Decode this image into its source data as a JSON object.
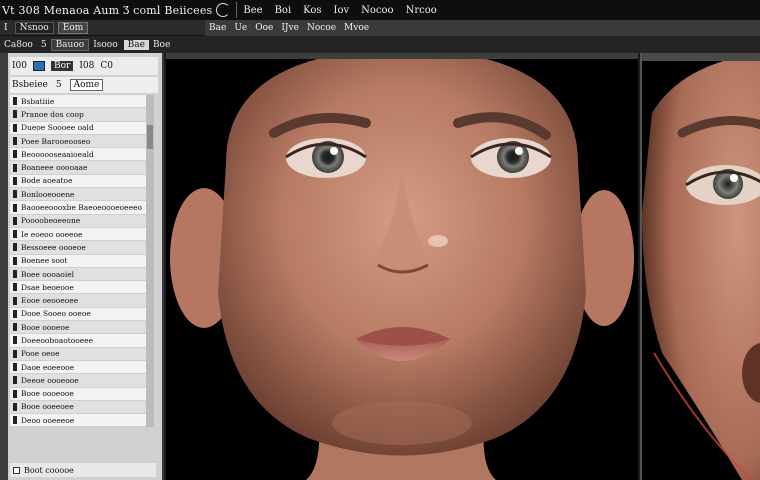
{
  "app": {
    "title": "Vt 308 Menaoa Aum Ʒ coml Beiicees",
    "menu": [
      "Bee",
      "Boi",
      "Kos",
      "Iov",
      "Nocoo",
      "Nrcoo"
    ]
  },
  "toolbar": {
    "left": [
      "I",
      "Nsnoo",
      "Eom"
    ],
    "right": [
      "Bae",
      "Ue",
      "Ooe",
      "IJve",
      "Nocoe",
      "Mvoe"
    ]
  },
  "toolbar2": {
    "items": [
      "Ca8oo",
      "5",
      "Bauoo",
      "Isooo",
      "Bae",
      "Boe"
    ]
  },
  "left_panel": {
    "header": [
      "I00",
      "Bor",
      "I08",
      "C0"
    ],
    "sub": [
      "Bsbeiee",
      "5",
      "Aome"
    ],
    "items": [
      "Bsbatiiie",
      "Pranoe dos coop",
      "Dueoe Soooee oald",
      "Poee Barooeooseo",
      "Beoooooseaaioeald",
      "Boaneee ooooaae",
      "Bode aoeatoe",
      "Bonlooeooene",
      "Baooeeoooxbe Baeoeoooeoeeeo",
      "Poooobeoeeone",
      "Ie eoeoo ooeeoe",
      "Bessoeee oooeoe",
      "Boenee soot",
      "Boee oooaoiel",
      "Dsae beoeooe",
      "Eooe oeooeoee",
      "Dooe Sooeo ooeoe",
      "Booe oooeoe",
      "Doeeooboaotooeee",
      "Pooe oeoe",
      "Daoe eoeeooe",
      "Deeoe oooeooe",
      "Booe oooeooe",
      "Booe ooeeoee",
      "Deoo ooeeeoe"
    ],
    "footer": "Boot cooooe"
  },
  "colors": {
    "titlebar": "#0e0e0e",
    "panel": "#d1d1d1",
    "viewport_bg": "#000000",
    "accent": "#2d6fb5"
  }
}
